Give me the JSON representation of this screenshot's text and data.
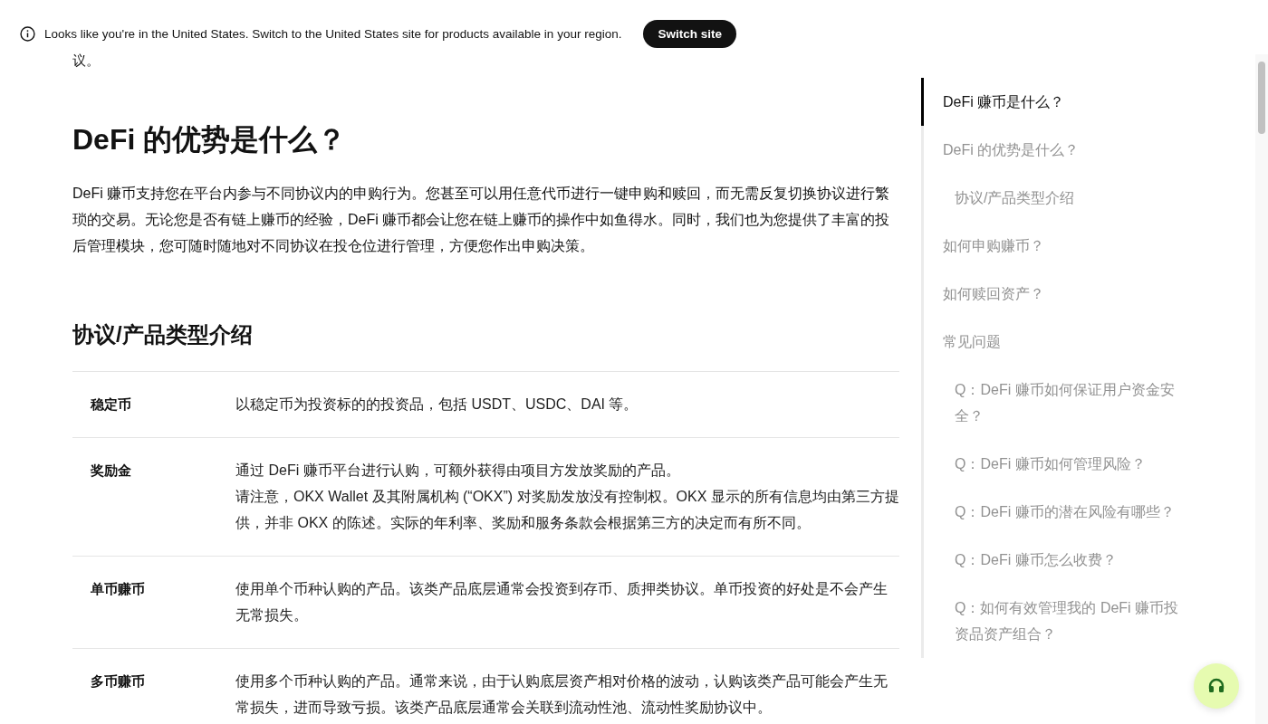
{
  "banner": {
    "message": "Looks like you're in the United States. Switch to the United States site for products available in your region.",
    "button": "Switch site"
  },
  "article": {
    "fragment": "议。",
    "heading": "DeFi 的优势是什么？",
    "paragraph": "DeFi 赚币支持您在平台内参与不同协议内的申购行为。您甚至可以用任意代币进行一键申购和赎回，而无需反复切换协议进行繁琐的交易。无论您是否有链上赚币的经验，DeFi 赚币都会让您在链上赚币的操作中如鱼得水。同时，我们也为您提供了丰富的投后管理模块，您可随时随地对不同协议在投仓位进行管理，方便您作出申购决策。",
    "subheading": "协议/产品类型介绍",
    "table": {
      "rows": [
        {
          "term": "稳定币",
          "lines": [
            "以稳定币为投资标的的投资品，包括 USDT、USDC、DAI 等。"
          ]
        },
        {
          "term": "奖励金",
          "lines": [
            "通过 DeFi 赚币平台进行认购，可额外获得由项目方发放奖励的产品。",
            "请注意，OKX Wallet 及其附属机构 (“OKX”) 对奖励发放没有控制权。OKX 显示的所有信息均由第三方提供，并非 OKX 的陈述。实际的年利率、奖励和服务条款会根据第三方的决定而有所不同。"
          ]
        },
        {
          "term": "单币赚币",
          "lines": [
            "使用单个币种认购的产品。该类产品底层通常会投资到存币、质押类协议。单币投资的好处是不会产生无常损失。"
          ]
        },
        {
          "term": "多币赚币",
          "lines": [
            "使用多个币种认购的产品。通常来说，由于认购底层资产相对价格的波动，认购该类产品可能会产生无常损失，进而导致亏损。该类产品底层通常会关联到流动性池、流动性奖励协议中。"
          ]
        }
      ]
    }
  },
  "toc": {
    "items": [
      {
        "label": "DeFi 赚币是什么？",
        "selected": true
      },
      {
        "label": "DeFi 的优势是什么？",
        "selected": false,
        "children": [
          {
            "label": "协议/产品类型介绍",
            "selected": false
          }
        ]
      },
      {
        "label": "如何申购赚币？",
        "selected": false
      },
      {
        "label": "如何赎回资产？",
        "selected": false
      },
      {
        "label": "常见问题",
        "selected": false,
        "children": [
          {
            "label": "Q：DeFi 赚币如何保证用户资金安全？",
            "selected": false
          },
          {
            "label": "Q：DeFi 赚币如何管理风险？",
            "selected": false
          },
          {
            "label": "Q：DeFi 赚币的潜在风险有哪些？",
            "selected": false
          },
          {
            "label": "Q：DeFi 赚币怎么收费？",
            "selected": false
          },
          {
            "label": "Q：如何有效管理我的 DeFi 赚币投资品资产组合？",
            "selected": false
          }
        ]
      }
    ]
  }
}
